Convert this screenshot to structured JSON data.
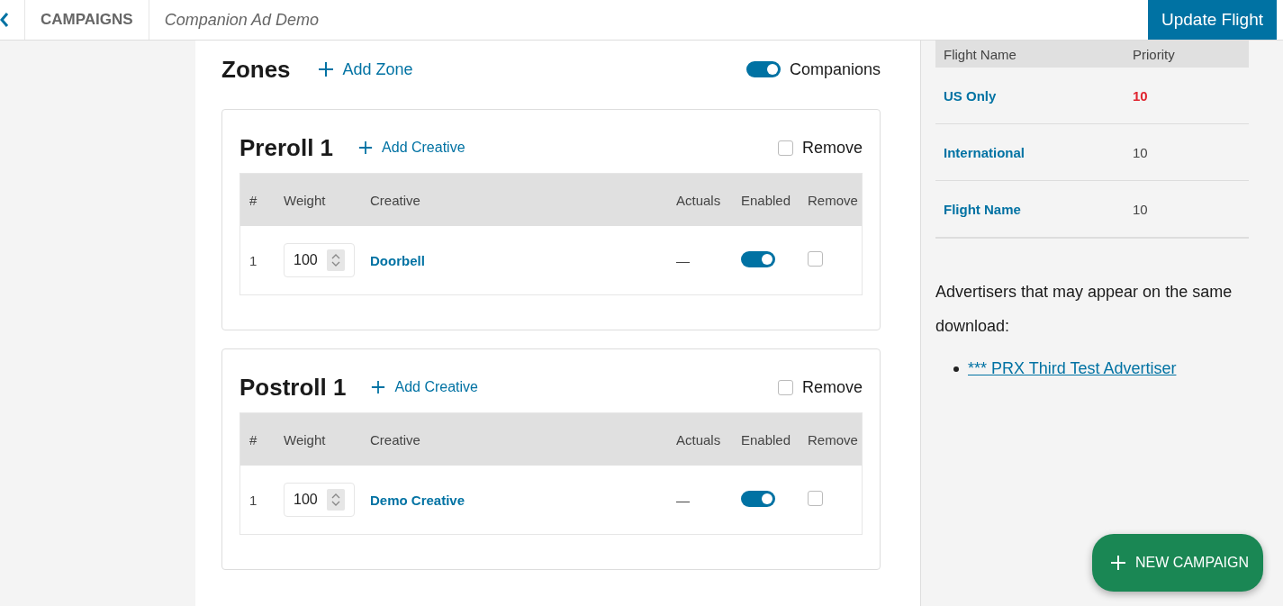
{
  "topbar": {
    "section": "CAMPAIGNS",
    "title": "Companion Ad Demo",
    "action": "Update Flight"
  },
  "zones": {
    "title": "Zones",
    "add_label": "Add Zone",
    "companions": {
      "label": "Companions",
      "on": true
    },
    "items": [
      {
        "title": "Preroll 1",
        "add_label": "Add Creative",
        "remove": {
          "label": "Remove",
          "checked": false
        },
        "columns": [
          "#",
          "Weight",
          "Creative",
          "Actuals",
          "Enabled",
          "Remove"
        ],
        "rows": [
          {
            "index": "1",
            "weight": "100",
            "creative": "Doorbell",
            "actuals": "—",
            "enabled": true,
            "remove": false
          }
        ]
      },
      {
        "title": "Postroll 1",
        "add_label": "Add Creative",
        "remove": {
          "label": "Remove",
          "checked": false
        },
        "columns": [
          "#",
          "Weight",
          "Creative",
          "Actuals",
          "Enabled",
          "Remove"
        ],
        "rows": [
          {
            "index": "1",
            "weight": "100",
            "creative": "Demo Creative",
            "actuals": "—",
            "enabled": true,
            "remove": false
          }
        ]
      }
    ]
  },
  "flights": {
    "columns": [
      "Flight Name",
      "Priority"
    ],
    "rows": [
      {
        "name": "US Only",
        "priority": "10",
        "highlight": true
      },
      {
        "name": "International",
        "priority": "10",
        "highlight": false
      },
      {
        "name": "Flight Name",
        "priority": "10",
        "highlight": false
      }
    ]
  },
  "advertisers": {
    "text": "Advertisers that may appear on the same download:",
    "items": [
      "*** PRX Third Test Advertiser"
    ]
  },
  "fab": {
    "label": "NEW CAMPAIGN"
  }
}
